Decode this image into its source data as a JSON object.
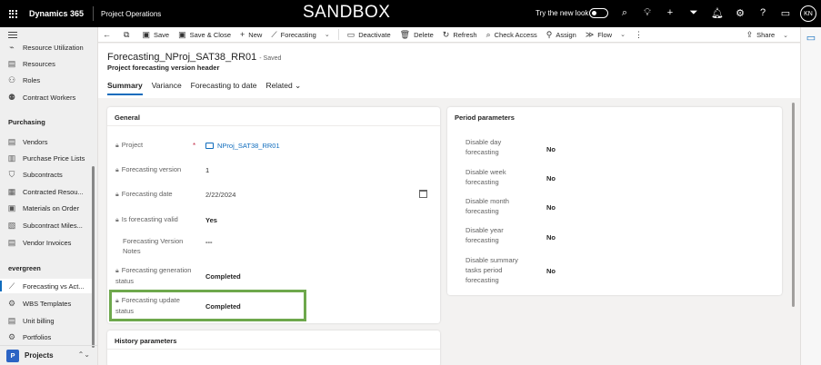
{
  "topbar": {
    "app_name": "Dynamics 365",
    "module": "Project Operations",
    "environment": "SANDBOX",
    "try_new_look": "Try the new look",
    "user_initials": "KN",
    "icons": [
      "search-icon",
      "lightbulb-icon",
      "plus-icon",
      "filter-icon",
      "bell-icon",
      "gear-icon",
      "help-icon",
      "chat-icon"
    ]
  },
  "nav": {
    "items": [
      {
        "label": "Resource Utilization",
        "icon": "resource-utilization-icon"
      },
      {
        "label": "Resources",
        "icon": "resources-icon"
      },
      {
        "label": "Roles",
        "icon": "roles-icon"
      },
      {
        "label": "Contract Workers",
        "icon": "contract-workers-icon"
      }
    ],
    "purchasing_header": "Purchasing",
    "purchasing": [
      {
        "label": "Vendors",
        "icon": "vendors-icon"
      },
      {
        "label": "Purchase Price Lists",
        "icon": "price-list-icon"
      },
      {
        "label": "Subcontracts",
        "icon": "subcontracts-icon"
      },
      {
        "label": "Contracted Resou...",
        "icon": "contracted-resources-icon"
      },
      {
        "label": "Materials on Order",
        "icon": "materials-icon"
      },
      {
        "label": "Subcontract Miles...",
        "icon": "milestones-icon"
      },
      {
        "label": "Vendor Invoices",
        "icon": "vendor-invoices-icon"
      }
    ],
    "evergreen_header": "evergreen",
    "evergreen": [
      {
        "label": "Forecasting vs Act...",
        "icon": "chart-icon",
        "active": true
      },
      {
        "label": "WBS Templates",
        "icon": "wbs-templates-icon"
      },
      {
        "label": "Unit billing",
        "icon": "unit-billing-icon"
      },
      {
        "label": "Portfolios",
        "icon": "portfolios-icon"
      }
    ],
    "area_badge": "P",
    "area_label": "Projects"
  },
  "commandbar": {
    "save": "Save",
    "save_close": "Save & Close",
    "new": "New",
    "forecasting": "Forecasting",
    "deactivate": "Deactivate",
    "delete": "Delete",
    "refresh": "Refresh",
    "check_access": "Check Access",
    "assign": "Assign",
    "flow": "Flow",
    "share": "Share"
  },
  "header": {
    "title": "Forecasting_NProj_SAT38_RR01",
    "saved": "- Saved",
    "subtitle": "Project forecasting version header",
    "tabs": [
      "Summary",
      "Variance",
      "Forecasting to date",
      "Related"
    ]
  },
  "general": {
    "title": "General",
    "fields": [
      {
        "label": "Project",
        "value": "NProj_SAT38_RR01",
        "locked": true
      },
      {
        "label": "Forecasting version",
        "value": "1",
        "locked": true
      },
      {
        "label": "Forecasting date",
        "value": "2/22/2024",
        "locked": true
      },
      {
        "label": "Is forecasting valid",
        "value": "Yes",
        "locked": true
      },
      {
        "label": "Forecasting Version Notes",
        "value": "---",
        "locked": false
      },
      {
        "label": "Forecasting generation status",
        "value": "Completed",
        "locked": true
      },
      {
        "label": "Forecasting update status",
        "value": "Completed",
        "locked": true
      }
    ]
  },
  "period": {
    "title": "Period parameters",
    "fields": [
      {
        "label": "Disable day forecasting",
        "value": "No"
      },
      {
        "label": "Disable week forecasting",
        "value": "No"
      },
      {
        "label": "Disable month forecasting",
        "value": "No"
      },
      {
        "label": "Disable year forecasting",
        "value": "No"
      },
      {
        "label": "Disable summary tasks period forecasting",
        "value": "No"
      }
    ]
  },
  "history": {
    "title": "History parameters"
  },
  "colors": {
    "accent": "#0f6cbd",
    "highlight": "#6ea84c",
    "required": "#c4314b"
  }
}
